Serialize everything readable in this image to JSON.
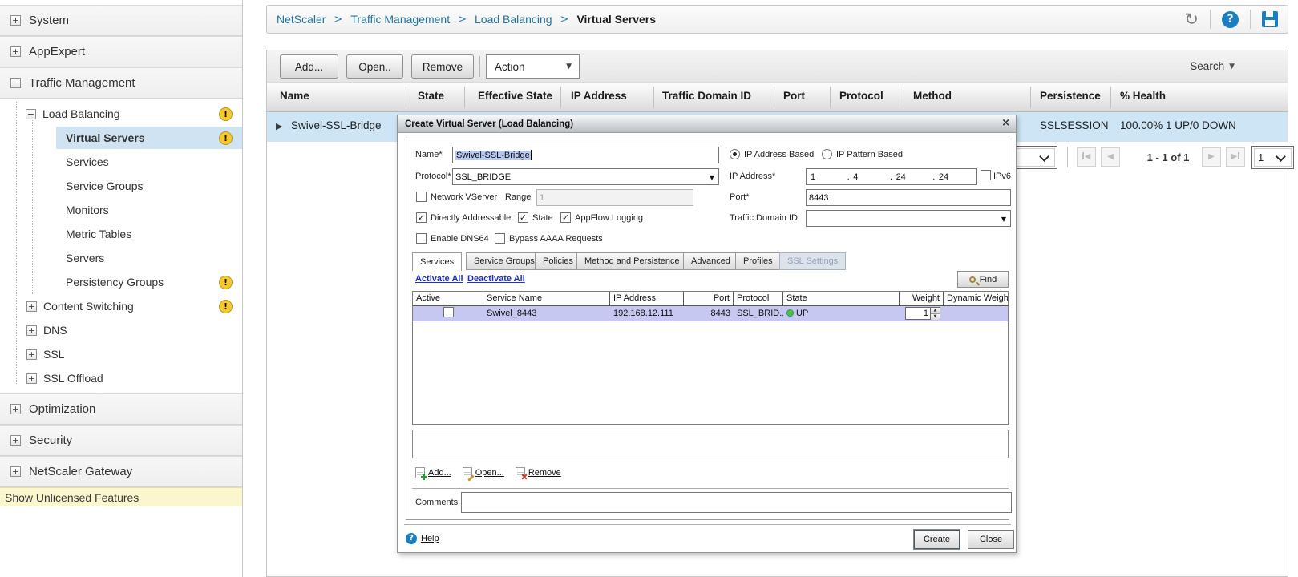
{
  "icons": {
    "expand": "+",
    "collapse": "−",
    "warning": "!",
    "refresh": "↻",
    "help": "?",
    "breadcrumb_sep": ">",
    "dropdown_arrow": "▼",
    "row_expander": "▶",
    "spin_up": "▲",
    "spin_down": "▼",
    "nav_prev": "◀",
    "nav_next": "▶",
    "close": "×",
    "check": "✓"
  },
  "sidebar": {
    "sections": [
      {
        "label": "System"
      },
      {
        "label": "AppExpert"
      },
      {
        "label": "Traffic Management"
      },
      {
        "label": "Optimization"
      },
      {
        "label": "Security"
      },
      {
        "label": "NetScaler Gateway"
      }
    ],
    "tree": {
      "load_balancing": {
        "label": "Load Balancing"
      },
      "children": [
        {
          "label": "Virtual Servers"
        },
        {
          "label": "Services"
        },
        {
          "label": "Service Groups"
        },
        {
          "label": "Monitors"
        },
        {
          "label": "Metric Tables"
        },
        {
          "label": "Servers"
        },
        {
          "label": "Persistency Groups"
        }
      ],
      "siblings": [
        {
          "label": "Content Switching"
        },
        {
          "label": "DNS"
        },
        {
          "label": "SSL"
        },
        {
          "label": "SSL Offload"
        }
      ]
    },
    "footer": "Show Unlicensed Features"
  },
  "breadcrumb": {
    "items": [
      "NetScaler",
      "Traffic Management",
      "Load Balancing"
    ],
    "current": "Virtual Servers"
  },
  "toolbar": {
    "add": "Add...",
    "open": "Open..",
    "remove": "Remove",
    "action": "Action",
    "search": "Search"
  },
  "table": {
    "columns": [
      "Name",
      "State",
      "Effective State",
      "IP Address",
      "Traffic Domain ID",
      "Port",
      "Protocol",
      "Method",
      "Persistence",
      "% Health"
    ],
    "row": {
      "name": "Swivel-SSL-Bridge",
      "persistence": "SSLSESSION",
      "health": "100.00% 1 UP/0 DOWN"
    }
  },
  "pagination": {
    "range": "1 - 1 of 1",
    "page": "1"
  },
  "dialog": {
    "title": "Create Virtual Server (Load Balancing)",
    "name_label": "Name*",
    "name_value": "Swivel-SSL-Bridge",
    "protocol_label": "Protocol*",
    "protocol_value": "SSL_BRIDGE",
    "ip_based": "IP Address Based",
    "ip_pattern": "IP Pattern Based",
    "ip_label": "IP Address*",
    "ip_octets": [
      "1",
      "4",
      "24",
      "24"
    ],
    "ip_sep": ".",
    "ipv6_label": "IPv6",
    "network_vserver": "Network VServer",
    "range_label": "Range",
    "range_value": "1",
    "port_label": "Port*",
    "port_value": "8443",
    "directly_addressable": "Directly Addressable",
    "state_label": "State",
    "appflow": "AppFlow Logging",
    "traffic_domain": "Traffic Domain ID",
    "enable_dns64": "Enable DNS64",
    "bypass_aaaa": "Bypass AAAA Requests",
    "tabs": [
      "Services",
      "Service Groups",
      "Policies",
      "Method and Persistence",
      "Advanced",
      "Profiles",
      "SSL Settings"
    ],
    "activate_all": "Activate All",
    "deactivate_all": "Deactivate All",
    "find": "Find",
    "services_table": {
      "columns": [
        "Active",
        "Service Name",
        "IP Address",
        "Port",
        "Protocol",
        "State",
        "Weight",
        "Dynamic Weight"
      ],
      "row": {
        "name": "Swivel_8443",
        "ip": "192.168.12.111",
        "port": "8443",
        "protocol": "SSL_BRID...",
        "state": "UP",
        "weight": "1"
      }
    },
    "add": "Add...",
    "open": "Open...",
    "remove": "Remove",
    "comments_label": "Comments",
    "help": "Help",
    "create": "Create",
    "close": "Close"
  }
}
